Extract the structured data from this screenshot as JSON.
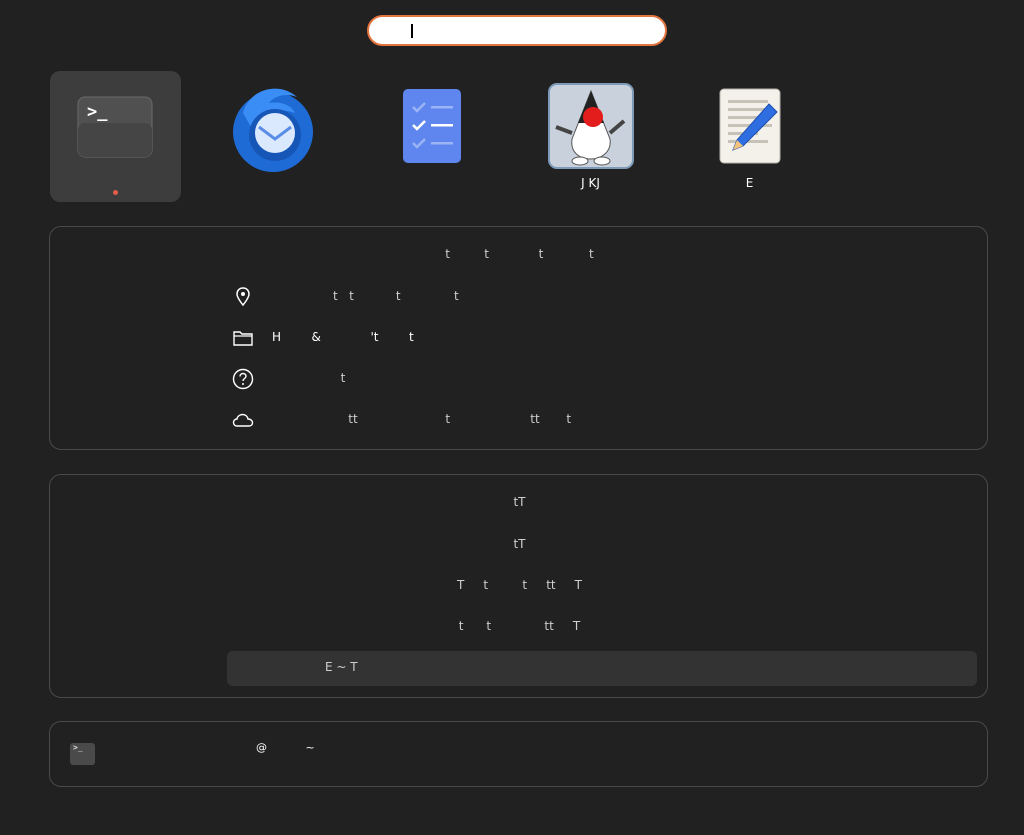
{
  "search": {
    "value": ""
  },
  "apps": [
    {
      "icon": "terminal-icon",
      "label": "",
      "active": true,
      "running": true
    },
    {
      "icon": "thunderbird-icon",
      "label": "",
      "active": false,
      "running": false
    },
    {
      "icon": "tasks-icon",
      "label": "",
      "active": false,
      "running": false
    },
    {
      "icon": "java-duke-icon",
      "label": "J  KJ",
      "active": false,
      "running": false
    },
    {
      "icon": "text-editor-icon",
      "label": "E",
      "active": false,
      "running": false
    }
  ],
  "settings_card": {
    "title": "t         t             t            t",
    "rows": [
      {
        "icon": "location-pin-icon",
        "text": "                t   t           t              t"
      },
      {
        "icon": "folder-icon",
        "text": "H        &             't        t"
      },
      {
        "icon": "help-icon",
        "text": "                  t"
      },
      {
        "icon": "cloud-icon",
        "text": "                    tt                       t                     tt       t"
      }
    ]
  },
  "results_card": {
    "lines": [
      "tT",
      "tT",
      "T     t         t     tt     T",
      "t      t              tt     T"
    ],
    "selected": "E ~ T"
  },
  "terminal_card": {
    "prompt_symbol": ">_",
    "line": "@           ~"
  },
  "colors": {
    "background": "#212121",
    "search_border": "#e2743f",
    "running_dot": "#e35d4a",
    "thunderbird_blue": "#1f6bd6",
    "tasks_blue": "#5e86ee"
  }
}
